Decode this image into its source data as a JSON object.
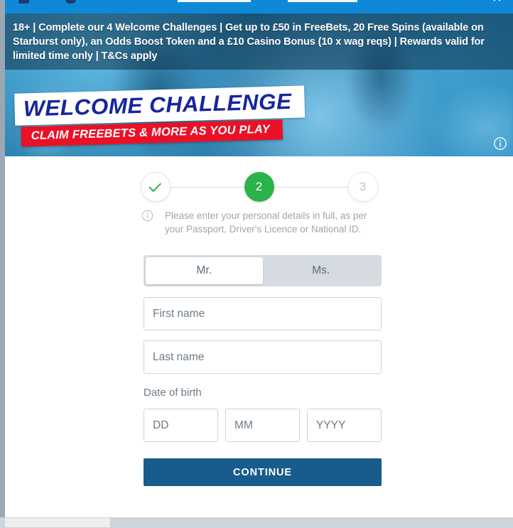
{
  "browser_bar": {
    "close_label": "✕",
    "icons": [
      "bookmark-icon",
      "shield-icon",
      "close-icon"
    ]
  },
  "banner": {
    "disclaimer": "18+ | Complete our 4 Welcome Challenges | Get up to £50 in FreeBets, 20 Free Spins (available on Starburst only), an Odds Boost Token and a £10 Casino Bonus (10 x wag reqs) | Rewards valid for limited time only | T&Cs apply",
    "headline": "WELCOME CHALLENGE",
    "subhead": "CLAIM FREEBETS & MORE AS YOU PLAY",
    "info_icon": "info-icon",
    "colors": {
      "headline_text": "#17269c",
      "subhead_background": "#ea1126",
      "banner_blue": "#2f93c9"
    }
  },
  "stepper": {
    "steps": [
      {
        "id": "step-1",
        "label": "✓",
        "state": "done"
      },
      {
        "id": "step-2",
        "label": "2",
        "state": "current"
      },
      {
        "id": "step-3",
        "label": "3",
        "state": "upcoming"
      }
    ],
    "active_color": "#2ab34a"
  },
  "note": {
    "icon": "info-icon",
    "text": "Please enter your personal details in full, as per your Passport, Driver's Licence or National ID."
  },
  "form": {
    "title_toggle": {
      "options": [
        {
          "label": "Mr.",
          "selected": true
        },
        {
          "label": "Ms.",
          "selected": false
        }
      ]
    },
    "first_name": {
      "value": "",
      "placeholder": "First name"
    },
    "last_name": {
      "value": "",
      "placeholder": "Last name"
    },
    "dob": {
      "label": "Date of birth",
      "day": {
        "value": "",
        "placeholder": "DD"
      },
      "month": {
        "value": "",
        "placeholder": "MM"
      },
      "year": {
        "value": "",
        "placeholder": "YYYY"
      }
    },
    "continue_label": "CONTINUE",
    "continue_color": "#175c8c"
  }
}
